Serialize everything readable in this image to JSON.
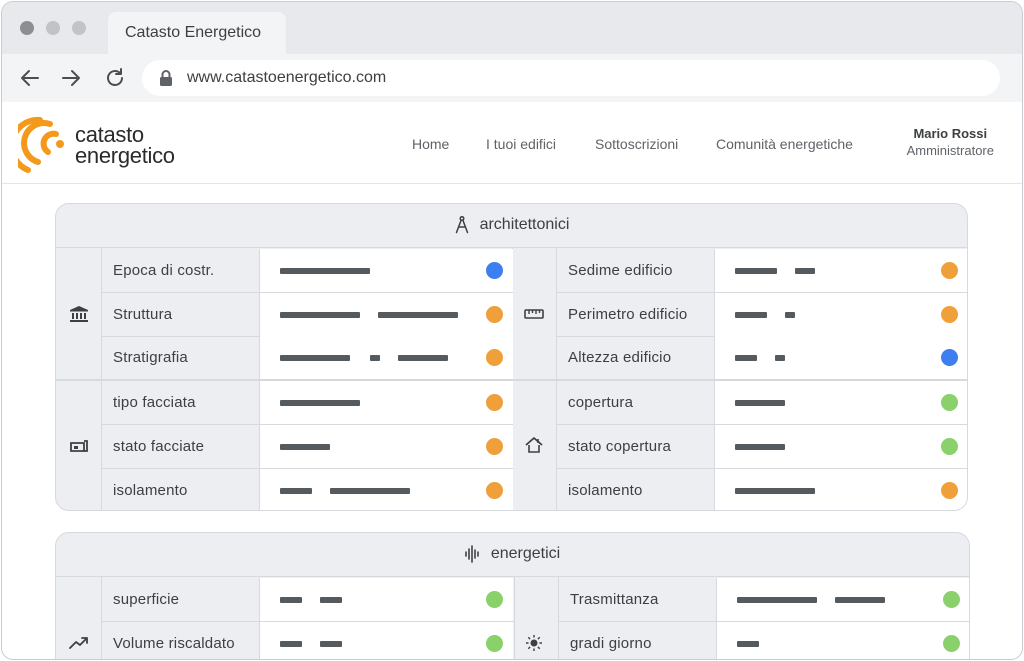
{
  "browser": {
    "tab_title": "Catasto Energetico",
    "url": "www.catastoenergetico.com"
  },
  "header": {
    "brand_line1": "catasto",
    "brand_line2": "energetico",
    "nav": [
      "Home",
      "I tuoi edifici",
      "Sottoscrizioni",
      "Comunità energetiche"
    ],
    "user_name": "Mario Rossi",
    "user_role": "Amministratore"
  },
  "colors": {
    "blue": "#3d7ff0",
    "orange": "#f0a03a",
    "green": "#8bd16b",
    "logo_orange": "#f39a1d"
  },
  "sections": [
    {
      "title": "architettonici",
      "icon": "compass-icon",
      "groups": [
        {
          "icon": "institution-icon",
          "rows": [
            {
              "label": "Epoca di costr.",
              "status": "blue"
            },
            {
              "label": "Struttura",
              "status": "orange"
            },
            {
              "label": "Stratigrafia",
              "status": "orange"
            }
          ]
        },
        {
          "icon": "ruler-icon",
          "rows": [
            {
              "label": "Sedime edificio",
              "status": "orange"
            },
            {
              "label": "Perimetro edificio",
              "status": "orange"
            },
            {
              "label": "Altezza edificio",
              "status": "blue"
            }
          ]
        },
        {
          "icon": "facade-icon",
          "rows": [
            {
              "label": "tipo facciata",
              "status": "orange"
            },
            {
              "label": "stato facciate",
              "status": "orange"
            },
            {
              "label": "isolamento",
              "status": "orange"
            }
          ]
        },
        {
          "icon": "roof-icon",
          "rows": [
            {
              "label": "copertura",
              "status": "green"
            },
            {
              "label": "stato copertura",
              "status": "green"
            },
            {
              "label": "isolamento",
              "status": "orange"
            }
          ]
        }
      ]
    },
    {
      "title": "energetici",
      "icon": "waveform-icon",
      "groups": [
        {
          "icon": "trend-icon",
          "rows": [
            {
              "label": "superficie",
              "status": "green"
            },
            {
              "label": "Volume riscaldato",
              "status": "green"
            }
          ]
        },
        {
          "icon": "sun-icon",
          "rows": [
            {
              "label": "Trasmittanza",
              "status": "green"
            },
            {
              "label": "gradi giorno",
              "status": "green"
            }
          ]
        }
      ]
    }
  ]
}
